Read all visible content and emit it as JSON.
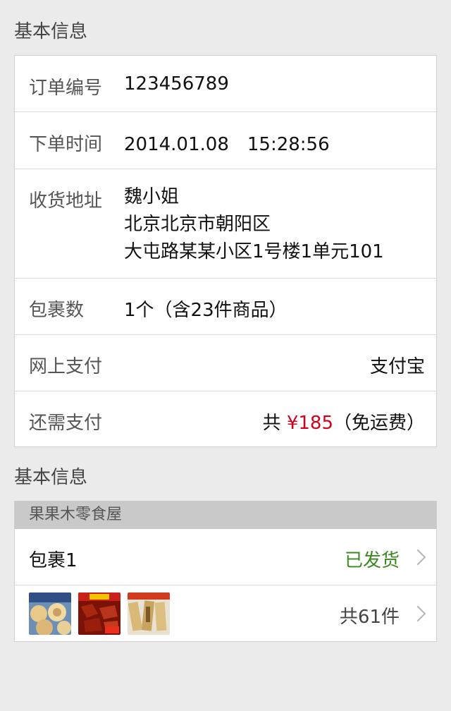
{
  "section1": {
    "title": "基本信息"
  },
  "order": {
    "number_label": "订单编号",
    "number_value": "123456789",
    "time_label": "下单时间",
    "time_value": "2014.01.08　15:28:56",
    "address_label": "收货地址",
    "address_lines": [
      "魏小姐",
      "北京北京市朝阳区",
      "大屯路某某小区1号楼1单元101"
    ],
    "packages_label": "包裹数",
    "packages_value": "1个（含23件商品）",
    "online_pay_label": "网上支付",
    "online_pay_value": "支付宝",
    "due_label": "还需支付",
    "due_prefix": "共",
    "due_amount": "¥185",
    "due_suffix": "（免运费）"
  },
  "section2": {
    "title": "基本信息"
  },
  "shop": {
    "name": "果果木零食屋",
    "package_label": "包裹1",
    "package_status": "已发货",
    "items_count": "共61件",
    "thumbnails": [
      "product-thumb-cookies",
      "product-thumb-spicy-meat",
      "product-thumb-snack-bars"
    ]
  },
  "colors": {
    "background": "#ebebeb",
    "price_red": "#d0021b",
    "shipped_green": "#3a8a1f",
    "shop_header": "#c9c9c9"
  }
}
